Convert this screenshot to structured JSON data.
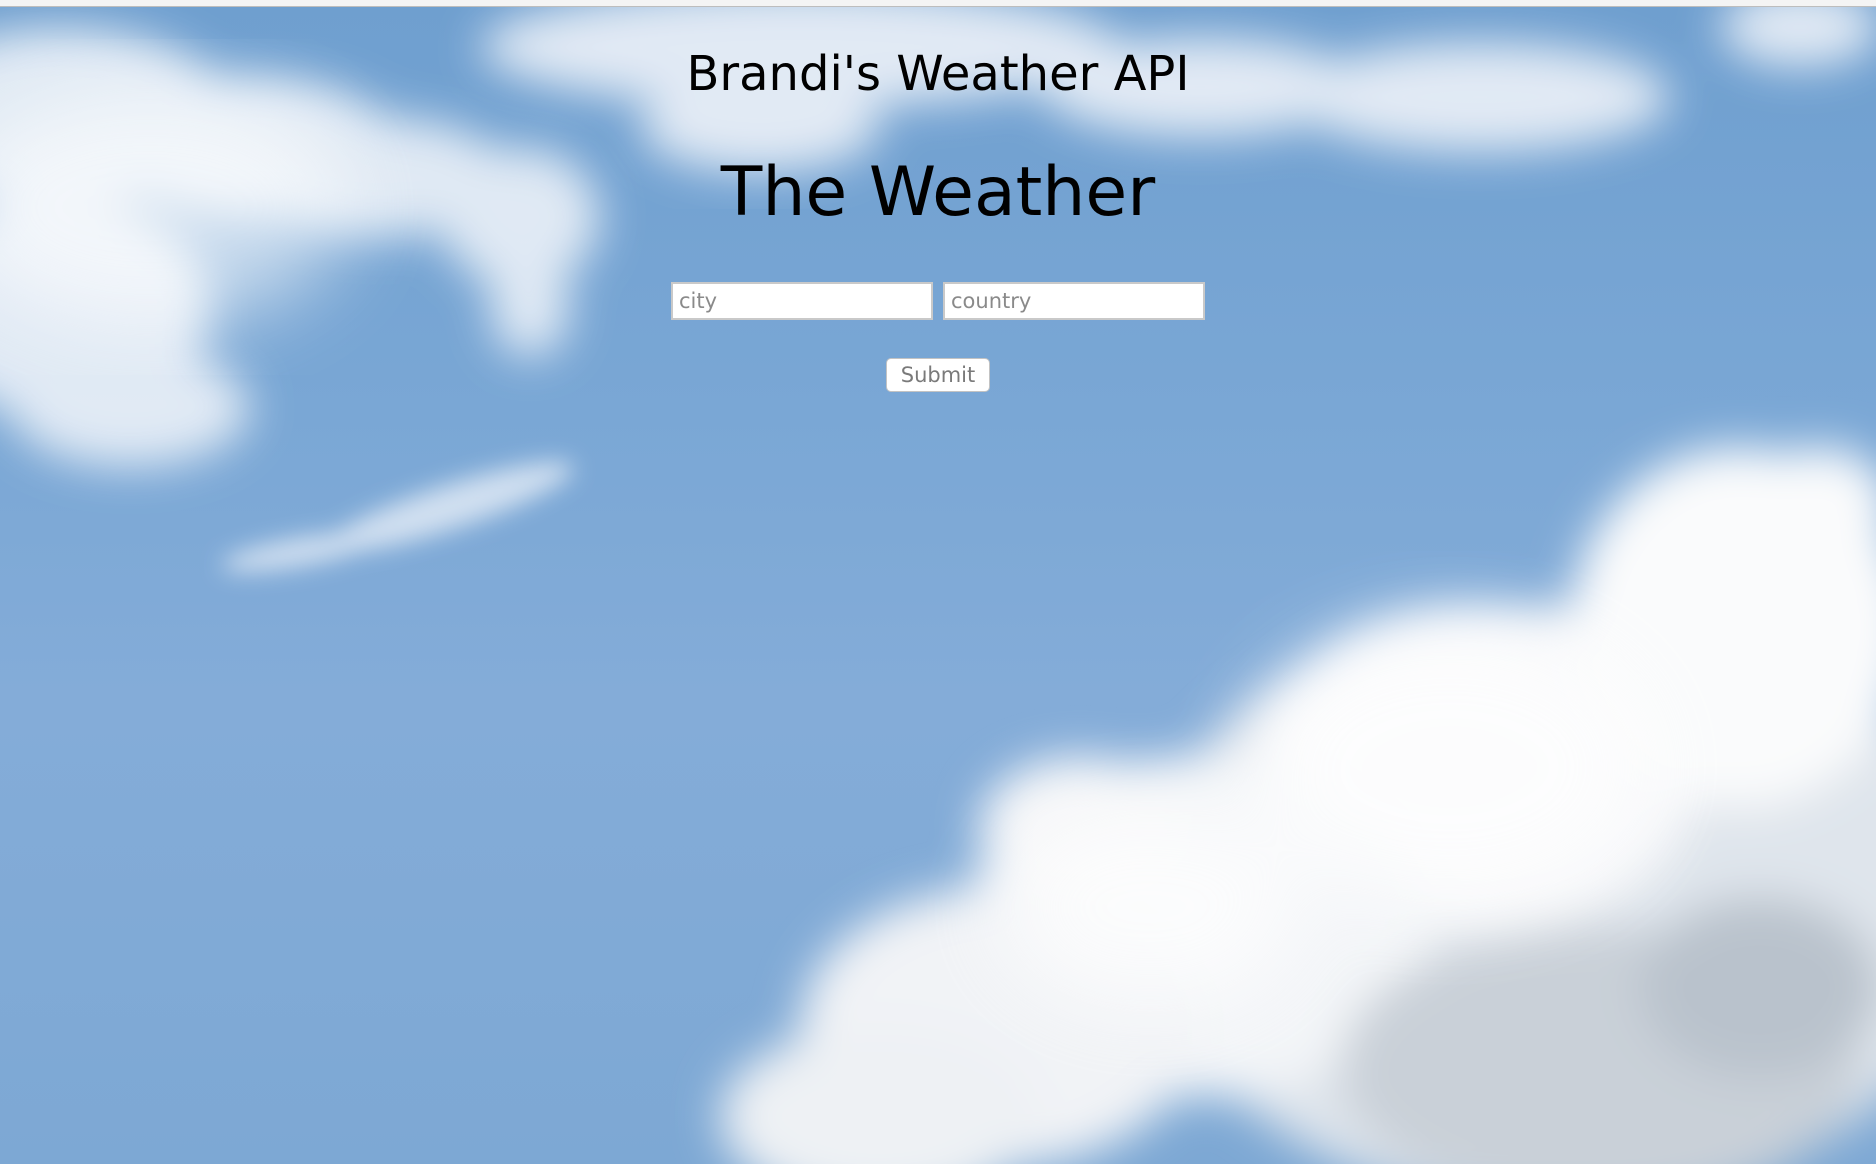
{
  "header": {
    "site_title": "Brandi's Weather API"
  },
  "main": {
    "heading": "The Weather",
    "form": {
      "city_placeholder": "city",
      "city_value": "",
      "country_placeholder": "country",
      "country_value": "",
      "submit_label": "Submit"
    }
  },
  "colors": {
    "sky_blue": "#7aa7d5",
    "cloud_white": "#f5f7fa",
    "text": "#000000"
  }
}
